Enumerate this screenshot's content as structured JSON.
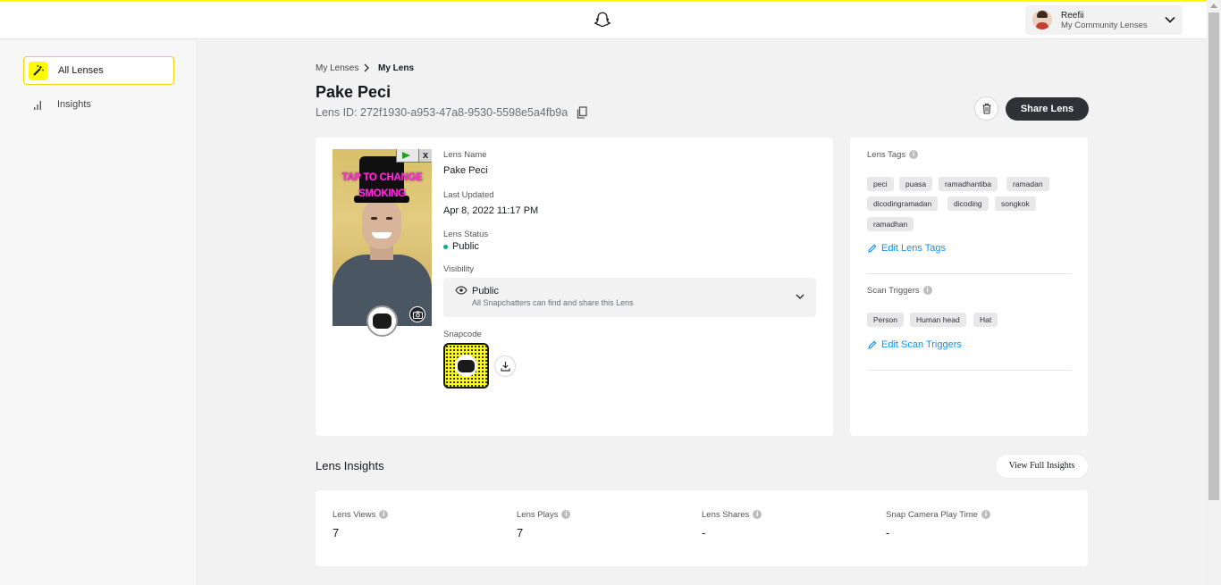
{
  "header": {
    "user_name": "Reefii",
    "user_subtitle": "My Community Lenses"
  },
  "sidebar": {
    "items": [
      {
        "label": "All Lenses",
        "icon": "magic-wand-icon",
        "active": true
      },
      {
        "label": "Insights",
        "icon": "bar-chart-icon",
        "active": false
      }
    ]
  },
  "breadcrumb": {
    "parent": "My Lenses",
    "current": "My Lens"
  },
  "lens": {
    "title": "Pake Peci",
    "id_text": "Lens ID: 272f1930-a953-47a8-9530-5598e5a4fb9a",
    "preview_overlay_text": "TAP TO CHANGE SMOKING",
    "name_label": "Lens Name",
    "name": "Pake Peci",
    "updated_label": "Last Updated",
    "updated": "Apr 8, 2022 11:17 PM",
    "status_label": "Lens Status",
    "status": "Public",
    "status_color": "#0fa987",
    "visibility_label": "Visibility",
    "visibility_value": "Public",
    "visibility_desc": "All Snapchatters can find and share this Lens",
    "snapcode_label": "Snapcode"
  },
  "actions": {
    "share_label": "Share Lens"
  },
  "tags_panel": {
    "tags_label": "Lens Tags",
    "tags": [
      "peci",
      "puasa",
      "ramadhantiba",
      "ramadan",
      "dicodingramadan",
      "dicoding",
      "songkok",
      "ramadhan"
    ],
    "edit_tags_label": "Edit Lens Tags",
    "triggers_label": "Scan Triggers",
    "triggers": [
      "Person",
      "Human head",
      "Hat"
    ],
    "edit_triggers_label": "Edit Scan Triggers"
  },
  "insights": {
    "heading": "Lens Insights",
    "view_full_label": "View Full Insights",
    "stats": [
      {
        "label": "Lens Views",
        "value": "7"
      },
      {
        "label": "Lens Plays",
        "value": "7"
      },
      {
        "label": "Lens Shares",
        "value": "-"
      },
      {
        "label": "Snap Camera Play Time",
        "value": "-"
      }
    ]
  },
  "colors": {
    "accent_yellow": "#fffc00",
    "link_blue": "#0894fa",
    "button_dark": "#2e3236"
  }
}
